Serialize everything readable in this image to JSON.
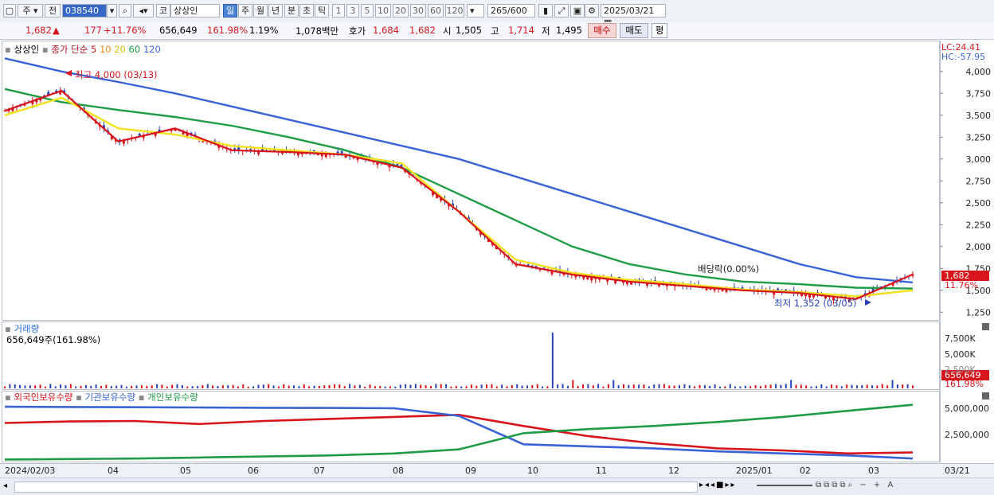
{
  "toolbar": {
    "market_label": "주",
    "prev_label": "전",
    "code": "038540",
    "code_prefix": "코",
    "stock_name": "상상인",
    "periods": [
      "일",
      "주",
      "월",
      "년",
      "분",
      "초",
      "틱"
    ],
    "intervals": [
      "1",
      "3",
      "5",
      "10",
      "20",
      "30",
      "60",
      "120"
    ],
    "count": "265",
    "count_max": "/600",
    "date": "2025/03/21"
  },
  "quote": {
    "price": "1,682",
    "arrow": "▲",
    "change": "177",
    "change_pct": "+11.76%",
    "volume": "656,649",
    "volume_ratio": "161.98%",
    "turnover": "1.19%",
    "amount": "1,078백만",
    "bid_label": "호가",
    "bid": "1,684",
    "ask": "1,682",
    "open_label": "시",
    "open": "1,505",
    "high_label": "고",
    "high": "1,714",
    "low_label": "저",
    "low": "1,495",
    "buy_button": "매수",
    "sell_button": "매도",
    "eval_button": "평"
  },
  "price_panel": {
    "legend_name": "상상인",
    "legend_ma": "종가 단순",
    "ma_periods": [
      "5",
      "10",
      "20",
      "60",
      "120"
    ],
    "ma_colors": [
      "#d8141c",
      "#f08a1a",
      "#f2e21e",
      "#1e9c46",
      "#3b63d8"
    ],
    "lc": "LC:24.41",
    "hc": "HC:-57.95",
    "current_badge": "1,682",
    "current_pct": "11.76%",
    "max_label": "최고 4,000 (03/13)",
    "min_label": "최저 1,352 (03/05)",
    "dividend_label": "배당락(0.00%)"
  },
  "volume_panel": {
    "title": "거래량",
    "value": "656,649주(161.98%)",
    "badge": "656,649",
    "badge_pct": "161.98%",
    "ticks": [
      "7,500K",
      "5,000K",
      "2,500K"
    ]
  },
  "holdings_panel": {
    "legend": [
      "외국인보유수량",
      "기관보유수량",
      "개인보유수량"
    ],
    "legend_colors": [
      "#d8141c",
      "#3b63d8",
      "#1e9c46"
    ],
    "ticks": [
      "5,000,000",
      "2,500,000"
    ]
  },
  "xaxis": {
    "labels": [
      "2024/02/03",
      "04",
      "05",
      "06",
      "07",
      "08",
      "09",
      "10",
      "11",
      "12",
      "2025/01",
      "02",
      "03",
      "03/21"
    ]
  },
  "chart_data": {
    "type": "line",
    "title": "",
    "y_ticks": [
      4000,
      3750,
      3500,
      3250,
      3000,
      2750,
      2500,
      2250,
      2000,
      1750,
      1500,
      1250
    ],
    "ylim": [
      1180,
      4180
    ],
    "series": [
      {
        "name": "120",
        "color": "#3b63d8",
        "values": [
          4150,
          4000,
          3880,
          3750,
          3600,
          3450,
          3300,
          3150,
          3000,
          2800,
          2600,
          2400,
          2200,
          2000,
          1800,
          1650,
          1590
        ]
      },
      {
        "name": "60",
        "color": "#1e9c46",
        "values": [
          3800,
          3650,
          3560,
          3480,
          3380,
          3250,
          3100,
          2900,
          2600,
          2300,
          2000,
          1800,
          1680,
          1600,
          1570,
          1530,
          1520
        ]
      },
      {
        "name": "20",
        "color": "#f2e21e",
        "values": [
          3500,
          3700,
          3350,
          3280,
          3150,
          3100,
          3050,
          2950,
          2400,
          1850,
          1700,
          1620,
          1570,
          1510,
          1480,
          1430,
          1500
        ]
      },
      {
        "name": "5",
        "color": "#d8141c",
        "values": [
          3550,
          3780,
          3200,
          3350,
          3100,
          3080,
          3050,
          2900,
          2400,
          1800,
          1680,
          1600,
          1550,
          1500,
          1470,
          1400,
          1682
        ]
      }
    ],
    "volume_spike_label": "",
    "holdings": {
      "외국인보유수량": [
        3800000,
        3950000,
        4000000,
        3700000,
        4000000,
        4200000,
        4400000,
        4600000,
        3500000,
        2500000,
        1800000,
        1300000,
        1100000,
        800000,
        900000
      ],
      "기관보유수량": [
        5400000,
        5380000,
        5350000,
        5330000,
        5300000,
        5280000,
        5250000,
        4500000,
        1700000,
        1500000,
        1300000,
        1000000,
        800000,
        600000,
        300000
      ],
      "개인보유수량": [
        200000,
        250000,
        300000,
        400000,
        500000,
        600000,
        800000,
        1200000,
        2800000,
        3200000,
        3500000,
        3900000,
        4400000,
        5000000,
        5600000
      ]
    }
  }
}
